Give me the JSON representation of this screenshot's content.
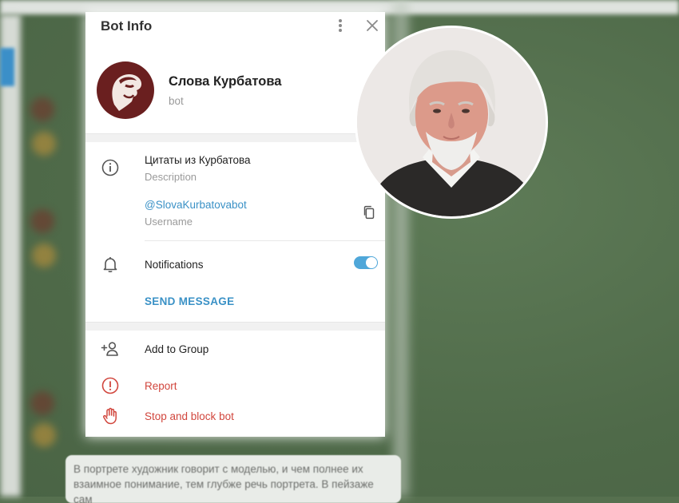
{
  "panel": {
    "title": "Bot Info"
  },
  "profile": {
    "name": "Слова Курбатова",
    "type": "bot"
  },
  "info": {
    "description_value": "Цитаты из Курбатова",
    "description_label": "Description",
    "username_value": "@SlovaKurbatovabot",
    "username_label": "Username",
    "notifications_label": "Notifications",
    "notifications_on": true,
    "send_message": "SEND MESSAGE"
  },
  "actions": {
    "add_to_group": "Add to Group",
    "report": "Report",
    "stop_block": "Stop and block bot"
  },
  "background_message": {
    "text": "В портрете художник говорит с моделью, и чем полнее их взаимное понимание, тем глубже речь портрета. В пейзаже сам"
  },
  "colors": {
    "accent": "#3a91c6",
    "danger": "#d1463d",
    "toggle": "#4fa7d9"
  },
  "icons": {
    "menu": "more-vertical-icon",
    "close": "close-icon",
    "info": "info-icon",
    "copy": "copy-icon",
    "bell": "bell-icon",
    "add_user": "add-user-icon",
    "report": "alert-circle-icon",
    "stop": "hand-icon"
  }
}
